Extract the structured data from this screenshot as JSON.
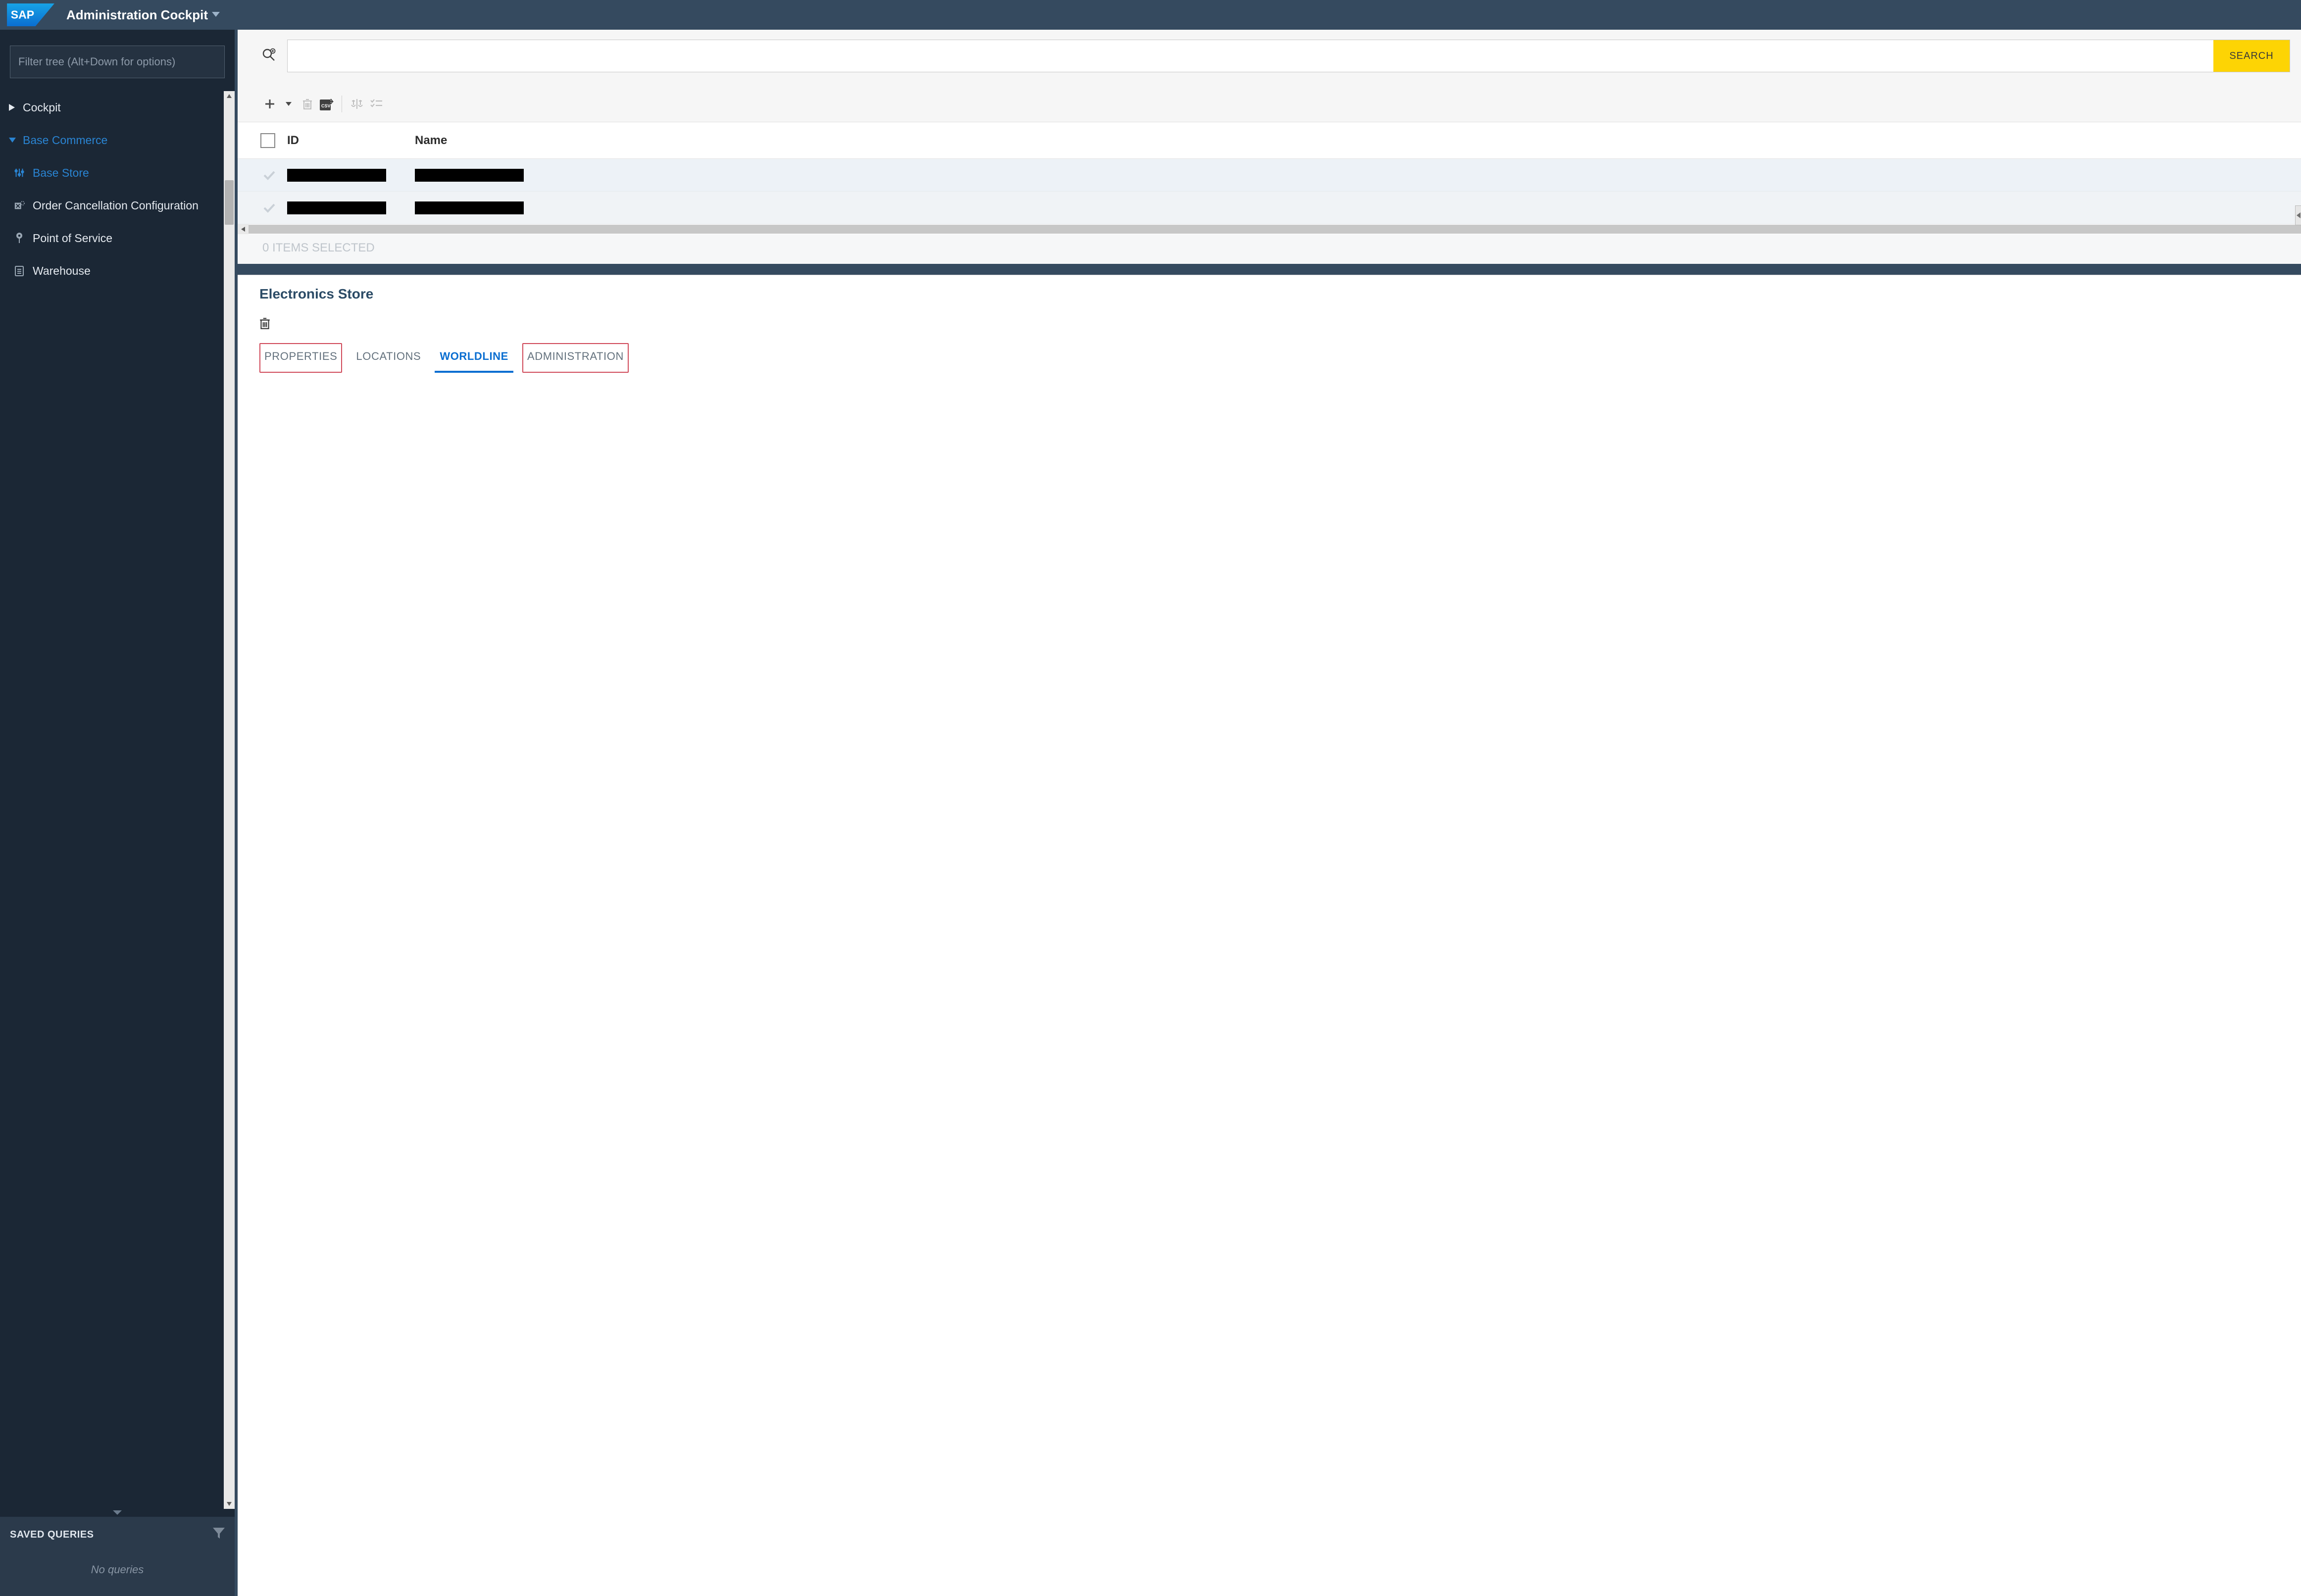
{
  "topbar": {
    "app_title": "Administration Cockpit"
  },
  "sidebar": {
    "filter_placeholder": "Filter tree (Alt+Down for options)",
    "tree": [
      {
        "label": "Cockpit",
        "expanded": false,
        "level": 1
      },
      {
        "label": "Base Commerce",
        "expanded": true,
        "level": 1
      },
      {
        "label": "Base Store",
        "level": 2,
        "active": true,
        "icon": "sliders"
      },
      {
        "label": "Order Cancellation Configuration",
        "level": 2,
        "icon": "cancel-config"
      },
      {
        "label": "Point of Service",
        "level": 2,
        "icon": "pin"
      },
      {
        "label": "Warehouse",
        "level": 2,
        "icon": "clipboard"
      }
    ],
    "saved_queries": {
      "title": "SAVED QUERIES",
      "empty_text": "No queries"
    }
  },
  "search": {
    "placeholder": "",
    "button_label": "SEARCH"
  },
  "table": {
    "columns": {
      "id": "ID",
      "name": "Name"
    },
    "rows": [
      {
        "id_redacted": true,
        "name_redacted": true
      },
      {
        "id_redacted": true,
        "name_redacted": true
      }
    ],
    "selection_status": "0 ITEMS SELECTED"
  },
  "editor": {
    "title": "Electronics Store",
    "tabs": [
      {
        "label": "PROPERTIES",
        "active": false,
        "highlighted": true
      },
      {
        "label": "LOCATIONS",
        "active": false,
        "highlighted": false
      },
      {
        "label": "WORLDLINE",
        "active": true,
        "highlighted": false
      },
      {
        "label": "ADMINISTRATION",
        "active": false,
        "highlighted": true
      }
    ]
  }
}
